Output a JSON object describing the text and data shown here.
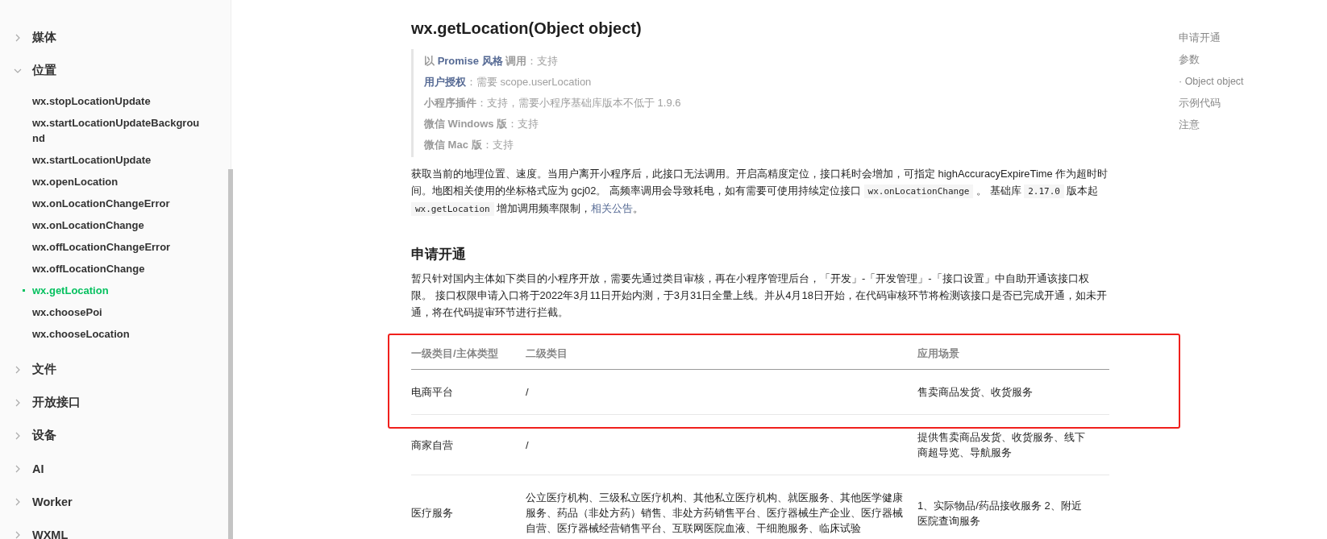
{
  "sidebar": {
    "items": [
      {
        "label": "媒体",
        "expanded": false
      },
      {
        "label": "位置",
        "expanded": true,
        "children": [
          {
            "label": "wx.stopLocationUpdate",
            "selected": false
          },
          {
            "label": "wx.startLocationUpdateBackground",
            "selected": false
          },
          {
            "label": "wx.startLocationUpdate",
            "selected": false
          },
          {
            "label": "wx.openLocation",
            "selected": false
          },
          {
            "label": "wx.onLocationChangeError",
            "selected": false
          },
          {
            "label": "wx.onLocationChange",
            "selected": false
          },
          {
            "label": "wx.offLocationChangeError",
            "selected": false
          },
          {
            "label": "wx.offLocationChange",
            "selected": false
          },
          {
            "label": "wx.getLocation",
            "selected": true
          },
          {
            "label": "wx.choosePoi",
            "selected": false
          },
          {
            "label": "wx.chooseLocation",
            "selected": false
          }
        ]
      },
      {
        "label": "文件",
        "expanded": false
      },
      {
        "label": "开放接口",
        "expanded": false
      },
      {
        "label": "设备",
        "expanded": false
      },
      {
        "label": "AI",
        "expanded": false
      },
      {
        "label": "Worker",
        "expanded": false
      },
      {
        "label": "WXML",
        "expanded": false
      }
    ]
  },
  "title": "wx.getLocation(Object object)",
  "support_notes": [
    [
      {
        "kind": "bold",
        "text": "以 "
      },
      {
        "kind": "link",
        "text": "Promise 风格"
      },
      {
        "kind": "bold",
        "text": " 调用"
      },
      {
        "kind": "plain",
        "text": "：支持"
      }
    ],
    [
      {
        "kind": "link",
        "text": "用户授权"
      },
      {
        "kind": "plain",
        "text": "：需要 scope.userLocation"
      }
    ],
    [
      {
        "kind": "bold",
        "text": "小程序插件"
      },
      {
        "kind": "plain",
        "text": "：支持，需要小程序基础库版本不低于 1.9.6"
      }
    ],
    [
      {
        "kind": "bold",
        "text": "微信 Windows 版"
      },
      {
        "kind": "plain",
        "text": "：支持"
      }
    ],
    [
      {
        "kind": "bold",
        "text": "微信 Mac 版"
      },
      {
        "kind": "plain",
        "text": "：支持"
      }
    ]
  ],
  "description": [
    {
      "kind": "text",
      "text": "获取当前的地理位置、速度。当用户离开小程序后，此接口无法调用。开启高精度定位，接口耗时会增加，可指定 highAccuracyExpireTime 作为超时时间。地图相关使用的坐标格式应为 gcj02。 高频率调用会导致耗电，如有需要可使用持续定位接口 "
    },
    {
      "kind": "code",
      "text": "wx.onLocationChange"
    },
    {
      "kind": "text",
      "text": " 。 基础库 "
    },
    {
      "kind": "code",
      "text": "2.17.0"
    },
    {
      "kind": "text",
      "text": " 版本起 "
    },
    {
      "kind": "code",
      "text": "wx.getLocation"
    },
    {
      "kind": "text",
      "text": " 增加调用频率限制，"
    },
    {
      "kind": "link",
      "text": "相关公告"
    },
    {
      "kind": "text",
      "text": "。"
    }
  ],
  "section": {
    "heading": "申请开通",
    "text": "暂只针对国内主体如下类目的小程序开放，需要先通过类目审核，再在小程序管理后台，「开发」-「开发管理」-「接口设置」中自助开通该接口权限。 接口权限申请入口将于2022年3月11日开始内测，于3月31日全量上线。并从4月18日开始，在代码审核环节将检测该接口是否已完成开通，如未开通，将在代码提审环节进行拦截。"
  },
  "table": {
    "columns": [
      "一级类目/主体类型",
      "二级类目",
      "应用场景"
    ],
    "rows": [
      [
        "电商平台",
        "/",
        "售卖商品发货、收货服务"
      ],
      [
        "商家自营",
        "/",
        "提供售卖商品发货、收货服务、线下商超导览、导航服务"
      ],
      [
        "医疗服务",
        "公立医疗机构、三级私立医疗机构、其他私立医疗机构、就医服务、其他医学健康服务、药品（非处方药）销售、非处方药销售平台、医疗器械生产企业、医疗器械自营、医疗器械经营销售平台、互联网医院血液、干细胞服务、临床试验",
        "1、实际物品/药品接收服务 2、附近医院查询服务"
      ]
    ]
  },
  "toc": [
    "申请开通",
    "参数",
    "· Object object",
    "示例代码",
    "注意"
  ]
}
